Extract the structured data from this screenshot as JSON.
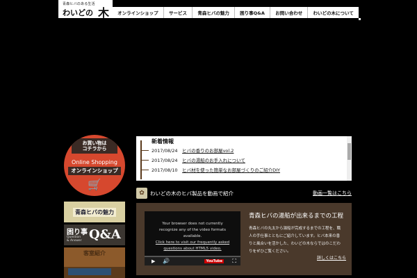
{
  "header": {
    "tagline": "青森ヒバのある生活",
    "brand": "わいどの",
    "brand_tree": "木",
    "nav": [
      {
        "label": "オンラインショップ"
      },
      {
        "label": "サービス"
      },
      {
        "label": "青森ヒバの魅力"
      },
      {
        "label": "困り事Q&A"
      },
      {
        "label": "お問い合わせ"
      },
      {
        "label": "わいどの木について"
      }
    ]
  },
  "sidebar": {
    "shop_banner": {
      "line1": "お買い物は",
      "line2": "コチラから",
      "en": "Online Shopping",
      "jp": "オンラインショップ",
      "icon": "cart-icon"
    },
    "hiba_banner": {
      "label": "青森ヒバの魅力"
    },
    "qa_banner": {
      "jp": "困り事",
      "sub1": "Question",
      "sub2": "& Answer",
      "qa": "Q&A"
    },
    "room_banner": {
      "label": "客室紹介"
    }
  },
  "news": {
    "heading": "新着情報",
    "items": [
      {
        "date": "2017/08/24",
        "title": "ヒバの香りのお部屋vol.2"
      },
      {
        "date": "2017/08/24",
        "title": "ヒバの湯船のお手入れについて"
      },
      {
        "date": "2017/08/10",
        "title": "ヒバ材を使った簡単なお部屋づくりのご紹介DIY"
      }
    ]
  },
  "video_section": {
    "title": "わいどの木のヒバ製品を動画で紹介",
    "more_link": "動画一覧はこちら",
    "player": {
      "message_lines": [
        "Your browser does not currently",
        "recognize any of the video formats",
        "available."
      ],
      "link_lines": [
        "Click here to visit our frequently asked",
        "questions about HTML5 video."
      ],
      "youtube_label": "YouTube"
    },
    "info": {
      "title": "青森ヒバの湯船が出来るまでの工程",
      "description": "青森ヒバの丸太から湯船が完成するまでの工程を、職人の手仕事とともにご紹介しています。ヒバ本来の香りと風合いを活かした、わいどの木ならではのこだわりをぜひご覧ください。",
      "detail_link": "詳しくはこちら"
    }
  },
  "colors": {
    "background": "#000000",
    "shop_red": "#d6482e",
    "panel_brown": "#4a392b"
  }
}
